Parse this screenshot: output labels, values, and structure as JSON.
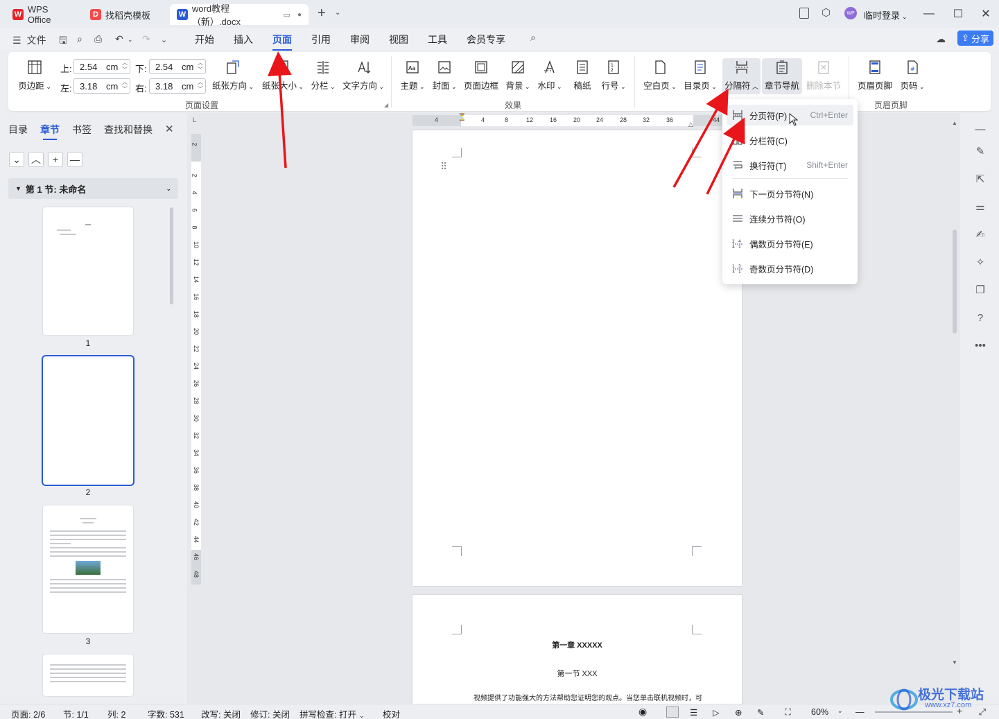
{
  "titlebar": {
    "tabs": [
      {
        "label": "WPS Office",
        "icon": "wps-logo-icon"
      },
      {
        "label": "找稻壳模板",
        "icon": "docer-logo-icon"
      },
      {
        "label": "word教程（新）.docx",
        "icon": "word-doc-icon"
      }
    ],
    "login_label": "临时登录",
    "avatar_text": "WP"
  },
  "menubar": {
    "file_label": "文件",
    "tabs": [
      "开始",
      "插入",
      "页面",
      "引用",
      "审阅",
      "视图",
      "工具",
      "会员专享"
    ],
    "active_tab": "页面",
    "share_label": "分享"
  },
  "ribbon": {
    "margins": {
      "top_label": "上:",
      "top_value": "2.54",
      "bottom_label": "下:",
      "bottom_value": "2.54",
      "left_label": "左:",
      "left_value": "3.18",
      "right_label": "右:",
      "right_value": "3.18",
      "unit": "cm"
    },
    "page_setup_buttons": [
      "页边距",
      "纸张方向",
      "纸张大小",
      "分栏",
      "文字方向"
    ],
    "effect_buttons": [
      "主题",
      "封面",
      "页面边框",
      "背景",
      "水印",
      "稿纸",
      "行号"
    ],
    "structure_buttons": [
      "空白页",
      "目录页",
      "分隔符",
      "章节导航",
      "删除本节"
    ],
    "header_buttons": [
      "页眉页脚",
      "页码"
    ],
    "groups": [
      "页面设置",
      "效果",
      "页眉页脚"
    ]
  },
  "breaks_menu": {
    "items": [
      {
        "label": "分页符(P)",
        "shortcut": "Ctrl+Enter"
      },
      {
        "label": "分栏符(C)",
        "shortcut": ""
      },
      {
        "label": "换行符(T)",
        "shortcut": "Shift+Enter"
      },
      {
        "label": "下一页分节符(N)",
        "shortcut": ""
      },
      {
        "label": "连续分节符(O)",
        "shortcut": ""
      },
      {
        "label": "偶数页分节符(E)",
        "shortcut": ""
      },
      {
        "label": "奇数页分节符(D)",
        "shortcut": ""
      }
    ]
  },
  "leftpanel": {
    "tabs": [
      "目录",
      "章节",
      "书签",
      "查找和替换"
    ],
    "active_tab": "章节",
    "section_title": "第 1 节: 未命名",
    "page_numbers": [
      "1",
      "2",
      "3"
    ],
    "selected_page": "2"
  },
  "ruler": {
    "h_ticks": [
      "4",
      "4",
      "8",
      "12",
      "16",
      "20",
      "24",
      "28",
      "32",
      "36",
      "44"
    ],
    "v_ticks": [
      "2",
      "2",
      "4",
      "6",
      "8",
      "10",
      "12",
      "14",
      "16",
      "18",
      "20",
      "22",
      "24",
      "26",
      "28",
      "30",
      "32",
      "34",
      "36",
      "38",
      "40",
      "42",
      "44",
      "46",
      "48"
    ]
  },
  "document": {
    "chapter_title": "第一章  XXXXX",
    "section_title": "第一节  XXX",
    "body_text": "视频提供了功能强大的方法帮助您证明您的观点。当您单击联机视频时，可"
  },
  "statusbar": {
    "page": "页面: 2/6",
    "section": "节: 1/1",
    "column": "列: 2",
    "word_count": "字数: 531",
    "revise_mode": "改写: 关闭",
    "track_changes": "修订: 关闭",
    "spell_check": "拼写检查: 打开",
    "proofread": "校对",
    "zoom": "60%"
  },
  "watermark_text": "极光下载站",
  "watermark_url": "www.xz7.com",
  "colors": {
    "accent": "#2a5bd7",
    "arrow": "#e8151b",
    "share": "#3b7cf5"
  }
}
